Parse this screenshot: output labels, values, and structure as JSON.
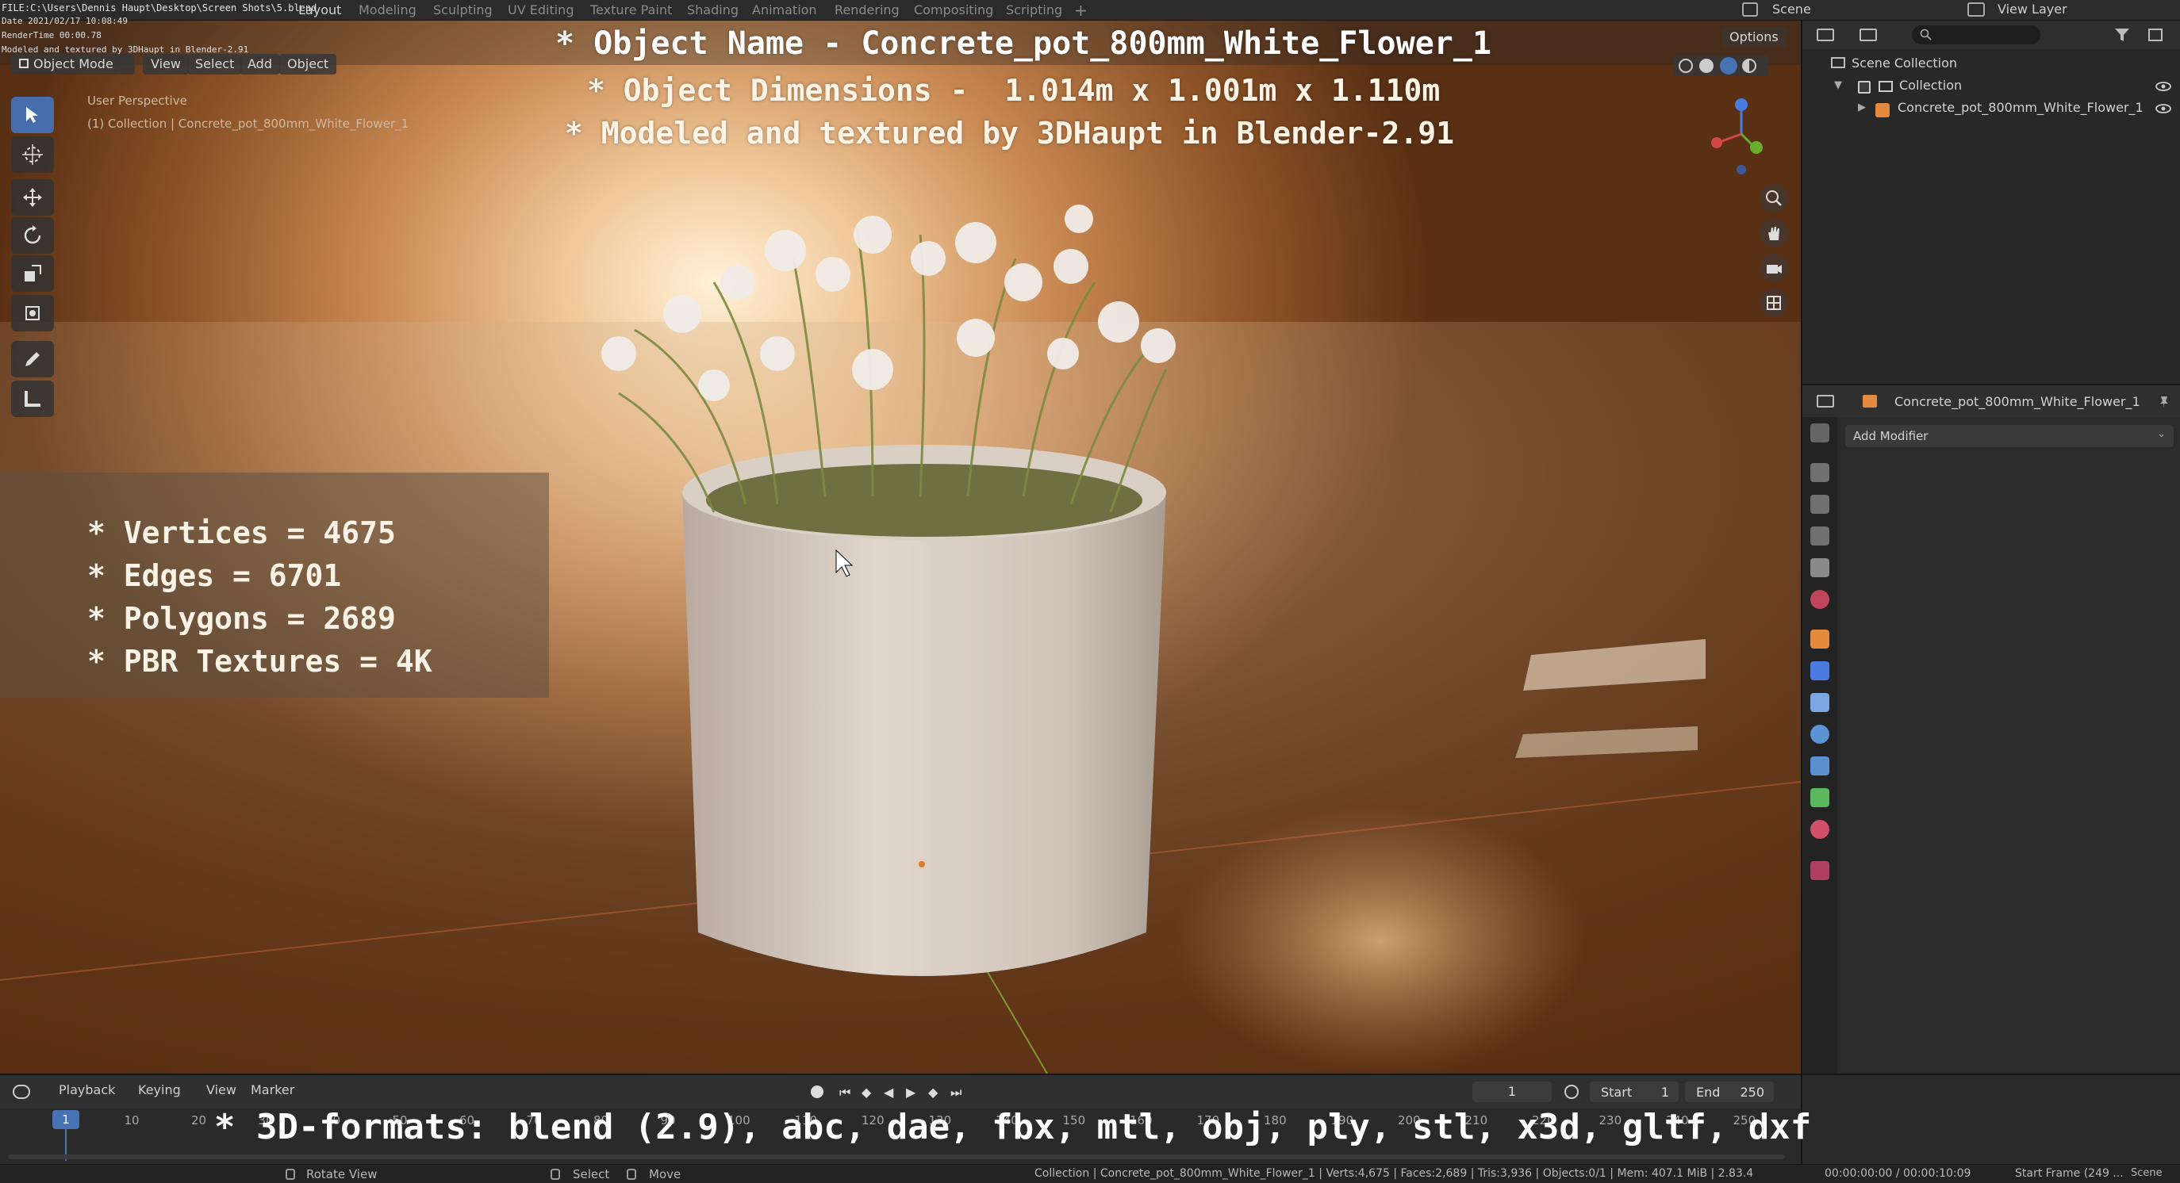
{
  "file_info": "FILE:C:\\Users\\Dennis Haupt\\Desktop\\Screen Shots\\5.blend",
  "render_meta": {
    "date": "Date 2021/02/17 10:08:49",
    "rendertime": "RenderTime 00:00.78",
    "note": "Modeled and textured by 3DHaupt in Blender-2.91"
  },
  "workspaces": [
    "Layout",
    "Modeling",
    "Sculpting",
    "UV Editing",
    "Texture Paint",
    "Shading",
    "Animation",
    "Rendering",
    "Compositing",
    "Scripting"
  ],
  "active_workspace": "Layout",
  "scene": "Scene",
  "view_layer": "View Layer",
  "viewport": {
    "mode": "Object Mode",
    "menus": [
      "View",
      "Select",
      "Add",
      "Object"
    ],
    "options": "Options",
    "perspective": "User Perspective",
    "collection_path": "(1) Collection | Concrete_pot_800mm_White_Flower_1"
  },
  "overlay": {
    "line1": "* Object Name - Concrete_pot_800mm_White_Flower_1",
    "line2": "* Object Dimensions -  1.014m x 1.001m x 1.110m",
    "line3": "* Modeled and textured by 3DHaupt in Blender-2.91",
    "stats": [
      "* Vertices = 4675",
      "* Edges = 6701",
      "* Polygons = 2689",
      "* PBR Textures = 4K"
    ],
    "formats": "* 3D-formats: blend (2.9), abc, dae, fbx, mtl, obj, ply, stl, x3d, gltf, dxf"
  },
  "outliner": {
    "scene_collection": "Scene Collection",
    "collection": "Collection",
    "object": "Concrete_pot_800mm_White_Flower_1"
  },
  "properties": {
    "object": "Concrete_pot_800mm_White_Flower_1",
    "add_modifier": "Add Modifier"
  },
  "timeline": {
    "menus": [
      "Playback",
      "Keying",
      "View",
      "Marker"
    ],
    "current_frame": "1",
    "start_label": "Start",
    "start": "1",
    "end_label": "End",
    "end": "250",
    "ticks": [
      "10",
      "20",
      "30",
      "40",
      "50",
      "60",
      "70",
      "80",
      "90",
      "100",
      "110",
      "120",
      "130",
      "140",
      "150",
      "160",
      "170",
      "180",
      "190",
      "200",
      "210",
      "220",
      "230",
      "240",
      "250"
    ]
  },
  "status": {
    "rotate": "Rotate View",
    "select": "Select",
    "move": "Move",
    "info": "Collection | Concrete_pot_800mm_White_Flower_1 | Verts:4,675 | Faces:2,689 | Tris:3,936 | Objects:0/1 | Mem: 407.1 MiB | 2.83.4",
    "time": "00:00:00:00 / 00:00:10:09",
    "start_frame": "Start Frame (249 ...",
    "scene_right": "Scene"
  },
  "colors": {
    "accent": "#4772b3",
    "header": "#2b2b2b",
    "panel": "#282828"
  }
}
